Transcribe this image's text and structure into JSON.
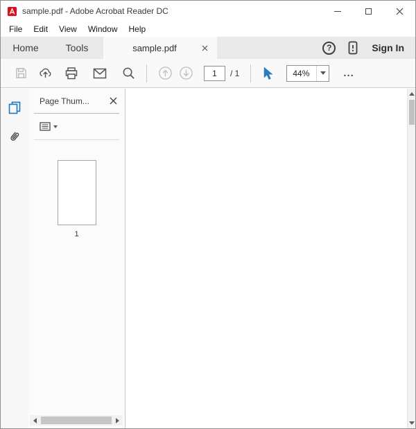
{
  "window": {
    "title": "sample.pdf - Adobe Acrobat Reader DC"
  },
  "menubar": {
    "items": [
      "File",
      "Edit",
      "View",
      "Window",
      "Help"
    ]
  },
  "tabbar": {
    "home_label": "Home",
    "tools_label": "Tools",
    "document_tab_label": "sample.pdf",
    "help_glyph": "?",
    "sign_in_label": "Sign In"
  },
  "toolbar": {
    "page_current": "1",
    "page_total": "/ 1",
    "zoom_value": "44%",
    "more_label": "..."
  },
  "sidebar": {
    "panel_title": "Page Thum...",
    "thumbnail_page_label": "1"
  },
  "colors": {
    "accent_blue": "#1a77c2",
    "acrobat_red": "#d6131c",
    "toolbar_bg": "#f9f9f9",
    "tabbar_bg": "#e9e9e9"
  }
}
